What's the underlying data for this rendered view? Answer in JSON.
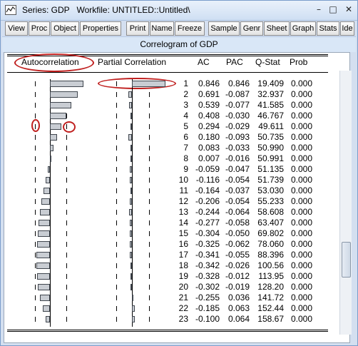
{
  "window": {
    "title": "Series: GDP   Workfile: UNTITLED::Untitled\\",
    "controls": {
      "minimize": "–",
      "maximize": "□",
      "close": "✕"
    }
  },
  "toolbar": {
    "buttons": [
      "View",
      "Proc",
      "Object",
      "Properties",
      "Print",
      "Name",
      "Freeze",
      "Sample",
      "Genr",
      "Sheet",
      "Graph",
      "Stats",
      "Ide"
    ]
  },
  "correlogram": {
    "title": "Correlogram of GDP",
    "headers": {
      "autocorrelation": "Autocorrelation",
      "partial_correlation": "Partial Correlation",
      "ac": "AC",
      "pac": "PAC",
      "qstat": "Q-Stat",
      "prob": "Prob"
    },
    "rows": [
      {
        "lag": "1",
        "ac": "0.846",
        "pac": "0.846",
        "q": "19.409",
        "p": "0.000"
      },
      {
        "lag": "2",
        "ac": "0.691",
        "pac": "-0.087",
        "q": "32.937",
        "p": "0.000"
      },
      {
        "lag": "3",
        "ac": "0.539",
        "pac": "-0.077",
        "q": "41.585",
        "p": "0.000"
      },
      {
        "lag": "4",
        "ac": "0.408",
        "pac": "-0.030",
        "q": "46.767",
        "p": "0.000"
      },
      {
        "lag": "5",
        "ac": "0.294",
        "pac": "-0.029",
        "q": "49.611",
        "p": "0.000"
      },
      {
        "lag": "6",
        "ac": "0.180",
        "pac": "-0.093",
        "q": "50.735",
        "p": "0.000"
      },
      {
        "lag": "7",
        "ac": "0.083",
        "pac": "-0.033",
        "q": "50.990",
        "p": "0.000"
      },
      {
        "lag": "8",
        "ac": "0.007",
        "pac": "-0.016",
        "q": "50.991",
        "p": "0.000"
      },
      {
        "lag": "9",
        "ac": "-0.059",
        "pac": "-0.047",
        "q": "51.135",
        "p": "0.000"
      },
      {
        "lag": "10",
        "ac": "-0.116",
        "pac": "-0.054",
        "q": "51.739",
        "p": "0.000"
      },
      {
        "lag": "11",
        "ac": "-0.164",
        "pac": "-0.037",
        "q": "53.030",
        "p": "0.000"
      },
      {
        "lag": "12",
        "ac": "-0.206",
        "pac": "-0.054",
        "q": "55.233",
        "p": "0.000"
      },
      {
        "lag": "13",
        "ac": "-0.244",
        "pac": "-0.064",
        "q": "58.608",
        "p": "0.000"
      },
      {
        "lag": "14",
        "ac": "-0.277",
        "pac": "-0.058",
        "q": "63.407",
        "p": "0.000"
      },
      {
        "lag": "15",
        "ac": "-0.304",
        "pac": "-0.050",
        "q": "69.802",
        "p": "0.000"
      },
      {
        "lag": "16",
        "ac": "-0.325",
        "pac": "-0.062",
        "q": "78.060",
        "p": "0.000"
      },
      {
        "lag": "17",
        "ac": "-0.341",
        "pac": "-0.055",
        "q": "88.396",
        "p": "0.000"
      },
      {
        "lag": "18",
        "ac": "-0.342",
        "pac": "-0.026",
        "q": "100.56",
        "p": "0.000"
      },
      {
        "lag": "19",
        "ac": "-0.328",
        "pac": "-0.012",
        "q": "113.95",
        "p": "0.000"
      },
      {
        "lag": "20",
        "ac": "-0.302",
        "pac": "-0.019",
        "q": "128.20",
        "p": "0.000"
      },
      {
        "lag": "21",
        "ac": "-0.255",
        "pac": "0.036",
        "q": "141.72",
        "p": "0.000"
      },
      {
        "lag": "22",
        "ac": "-0.185",
        "pac": "0.063",
        "q": "152.44",
        "p": "0.000"
      },
      {
        "lag": "23",
        "ac": "-0.100",
        "pac": "0.064",
        "q": "158.67",
        "p": "0.000"
      }
    ]
  }
}
